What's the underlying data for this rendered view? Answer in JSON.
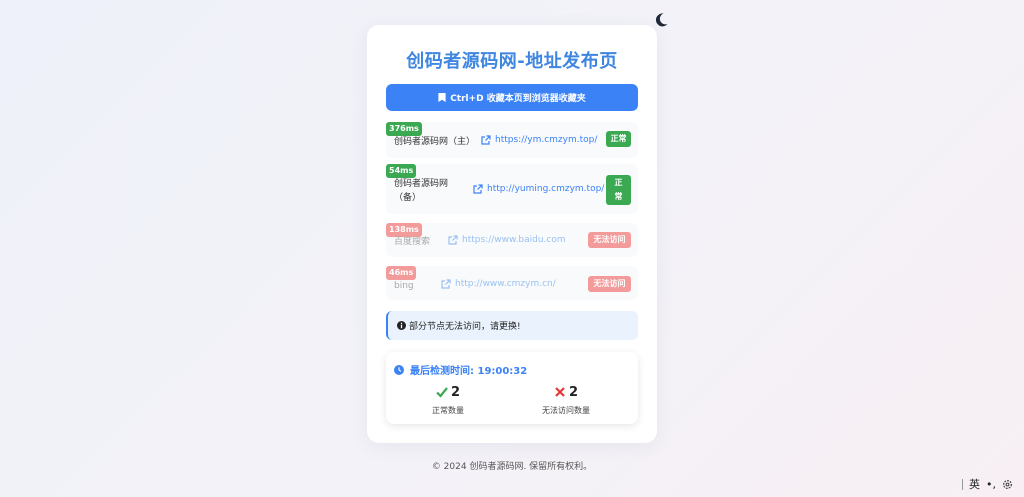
{
  "page": {
    "title": "创码者源码网-地址发布页",
    "bookmark_label": "Ctrl+D 收藏本页到浏览器收藏夹",
    "alert_text": "部分节点无法访问，请更换!",
    "footer": "© 2024 创码者源码网. 保留所有权利。"
  },
  "links": [
    {
      "latency": "376ms",
      "name": "创码者源码网（主）",
      "url": "https://ym.cmzym.top/",
      "status": "正常",
      "ok": true
    },
    {
      "latency": "54ms",
      "name": "创码者源码网（备）",
      "url": "http://yuming.cmzym.top/",
      "status": "正常",
      "ok": true
    },
    {
      "latency": "138ms",
      "name": "百度搜索",
      "url": "https://www.baidu.com",
      "status": "无法访问",
      "ok": false
    },
    {
      "latency": "46ms",
      "name": "bing",
      "url": "http://www.cmzym.cn/",
      "status": "无法访问",
      "ok": false
    }
  ],
  "stats": {
    "last_check_label": "最后检测时间: 19:00:32",
    "ok_count": "2",
    "ok_label": "正常数量",
    "fail_count": "2",
    "fail_label": "无法访问数量"
  },
  "ime": {
    "lang": "英",
    "punct": "•,",
    "settings_icon": "gear-icon"
  },
  "colors": {
    "accent": "#3b82f6",
    "ok": "#3aa952",
    "fail": "#f39b9b",
    "title": "#3f86e0"
  },
  "icons": {
    "theme": "moon-icon",
    "bookmark": "bookmark-icon",
    "link": "external-link-icon",
    "alert": "info-icon",
    "time": "clock-icon",
    "ok": "check-icon",
    "fail": "x-icon"
  }
}
